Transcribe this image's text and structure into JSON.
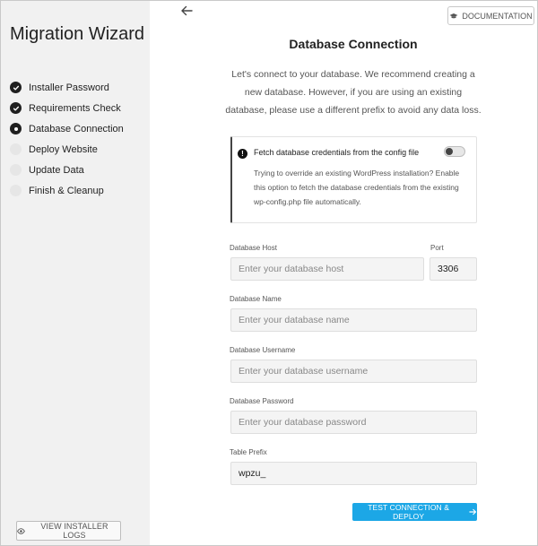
{
  "sidebar": {
    "title": "Migration Wizard",
    "steps": [
      {
        "label": "Installer Password",
        "state": "done"
      },
      {
        "label": "Requirements Check",
        "state": "done"
      },
      {
        "label": "Database Connection",
        "state": "current"
      },
      {
        "label": "Deploy Website",
        "state": "pending"
      },
      {
        "label": "Update Data",
        "state": "pending"
      },
      {
        "label": "Finish & Cleanup",
        "state": "pending"
      }
    ],
    "logs_button": "VIEW INSTALLER LOGS",
    "logs_icon": "eye-icon"
  },
  "header": {
    "back_icon": "arrow-left-icon",
    "docs_button": "DOCUMENTATION",
    "docs_icon": "graduation-cap-icon"
  },
  "main": {
    "title": "Database Connection",
    "intro": "Let's connect to your database. We recommend creating a new database. However, if you are using an existing database, please use a different prefix to avoid any data loss.",
    "notice": {
      "title": "Fetch database credentials from the config file",
      "description": "Trying to override an existing WordPress installation? Enable this option to fetch the database credentials from the existing wp-config.php file automatically.",
      "toggle_on": false
    },
    "fields": {
      "host": {
        "label": "Database Host",
        "value": "",
        "placeholder": "Enter your database host"
      },
      "port": {
        "label": "Port",
        "value": "3306",
        "placeholder": ""
      },
      "name": {
        "label": "Database Name",
        "value": "",
        "placeholder": "Enter your database name"
      },
      "username": {
        "label": "Database Username",
        "value": "",
        "placeholder": "Enter your database username"
      },
      "password": {
        "label": "Database Password",
        "value": "",
        "placeholder": "Enter your database password"
      },
      "prefix": {
        "label": "Table Prefix",
        "value": "wpzu_",
        "placeholder": ""
      }
    },
    "submit_button": "TEST CONNECTION & DEPLOY"
  },
  "colors": {
    "accent": "#1ca7e6",
    "sidebar_bg": "#f1f1f1",
    "step_done": "#1f1f1f",
    "step_pending": "#e6e6e6"
  }
}
